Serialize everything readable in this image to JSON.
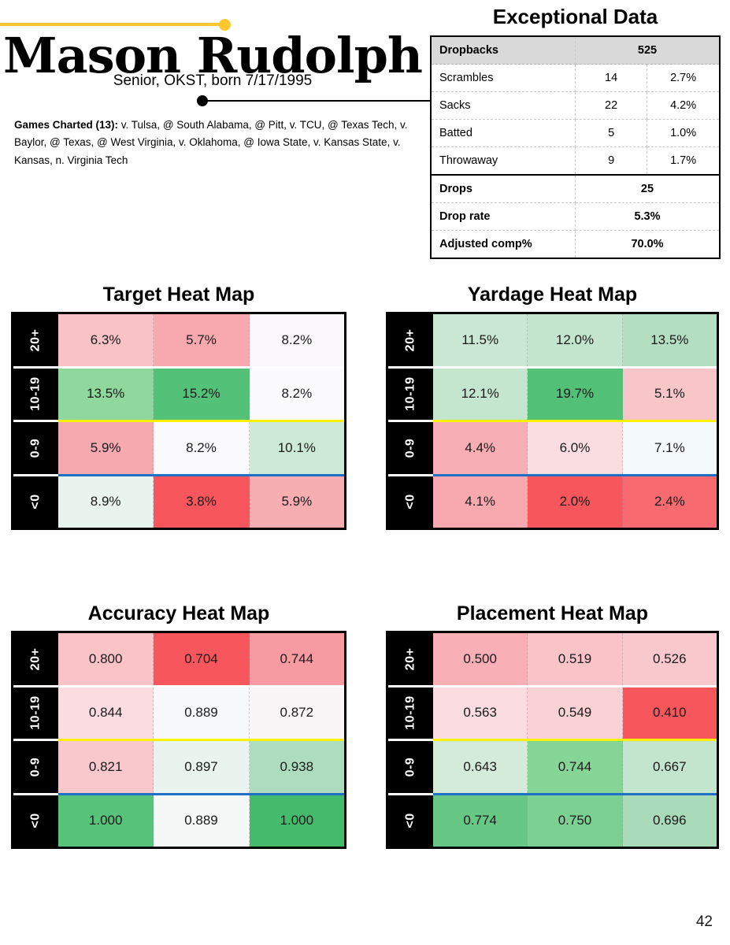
{
  "header": {
    "player_name": "Mason Rudolph",
    "subtitle": "Senior, OKST, born 7/17/1995",
    "games_label": "Games Charted (13):",
    "games_list": " v. Tulsa, @ South Alabama, @ Pitt, v. TCU, @ Texas Tech, v. Baylor, @ Texas, @ West Virginia, v. Oklahoma, @ Iowa State, v. Kansas State, v. Kansas, n. Virginia Tech",
    "accent_yellow": "#FDC82F",
    "connector_black": "#000000"
  },
  "exceptional": {
    "title": "Exceptional Data",
    "rows": [
      {
        "label": "Dropbacks",
        "value": "525",
        "pct": "",
        "style": "header",
        "span": true
      },
      {
        "label": "Scrambles",
        "value": "14",
        "pct": "2.7%",
        "style": "normal",
        "span": false
      },
      {
        "label": "Sacks",
        "value": "22",
        "pct": "4.2%",
        "style": "normal",
        "span": false
      },
      {
        "label": "Batted",
        "value": "5",
        "pct": "1.0%",
        "style": "normal",
        "span": false
      },
      {
        "label": "Throwaway",
        "value": "9",
        "pct": "1.7%",
        "style": "section-end",
        "span": false
      },
      {
        "label": "Drops",
        "value": "25",
        "pct": "",
        "style": "bold",
        "span": true
      },
      {
        "label": "Drop rate",
        "value": "5.3%",
        "pct": "",
        "style": "bold",
        "span": true
      },
      {
        "label": "Adjusted comp%",
        "value": "70.0%",
        "pct": "",
        "style": "bold",
        "span": true
      }
    ]
  },
  "heatmaps": {
    "row_labels": [
      "20+",
      "10-19",
      "0-9",
      "<0"
    ],
    "separators": [
      "white",
      "yellow",
      "blue"
    ],
    "separator_colors": {
      "white": "#FFFFFF",
      "yellow": "#FFF200",
      "blue": "#1F6FC4"
    },
    "maps": [
      {
        "key": "target",
        "title": "Target Heat Map",
        "values": [
          [
            "6.3%",
            "5.7%",
            "8.2%"
          ],
          [
            "13.5%",
            "15.2%",
            "8.2%"
          ],
          [
            "5.9%",
            "8.2%",
            "10.1%"
          ],
          [
            "8.9%",
            "3.8%",
            "5.9%"
          ]
        ],
        "colors": [
          [
            "#F9C2C6",
            "#F7A9AF",
            "#FAF8FB"
          ],
          [
            "#8FD79C",
            "#53C177",
            "#FBFAFC"
          ],
          [
            "#F6A9AF",
            "#FBFAFD",
            "#CEE9D5"
          ],
          [
            "#E9F4EE",
            "#F6565C",
            "#F6AEB3"
          ]
        ]
      },
      {
        "key": "yardage",
        "title": "Yardage Heat Map",
        "values": [
          [
            "11.5%",
            "12.0%",
            "13.5%"
          ],
          [
            "12.1%",
            "19.7%",
            "5.1%"
          ],
          [
            "4.4%",
            "6.0%",
            "7.1%"
          ],
          [
            "4.1%",
            "2.0%",
            "2.4%"
          ]
        ],
        "colors": [
          [
            "#C9E7D2",
            "#C3E5CE",
            "#B3DEC1"
          ],
          [
            "#C4E5CE",
            "#52C077",
            "#F8C5C9"
          ],
          [
            "#F7AEB4",
            "#FADDE0",
            "#F4F9FA"
          ],
          [
            "#F7A9AF",
            "#F6565C",
            "#F66A70"
          ]
        ]
      },
      {
        "key": "accuracy",
        "title": "Accuracy Heat Map",
        "values": [
          [
            "0.800",
            "0.704",
            "0.744"
          ],
          [
            "0.844",
            "0.889",
            "0.872"
          ],
          [
            "0.821",
            "0.897",
            "0.938"
          ],
          [
            "1.000",
            "0.889",
            "1.000"
          ]
        ],
        "colors": [
          [
            "#F9C3C7",
            "#F6565C",
            "#F79BA2"
          ],
          [
            "#FBDCE0",
            "#F6F8F9",
            "#FAF6F8"
          ],
          [
            "#F9C8CC",
            "#E9F4EE",
            "#AEDCBE"
          ],
          [
            "#56C27A",
            "#F4F8F7",
            "#44BA6C"
          ]
        ]
      },
      {
        "key": "placement",
        "title": "Placement Heat Map",
        "values": [
          [
            "0.500",
            "0.519",
            "0.526"
          ],
          [
            "0.563",
            "0.549",
            "0.410"
          ],
          [
            "0.643",
            "0.744",
            "0.667"
          ],
          [
            "0.774",
            "0.750",
            "0.696"
          ]
        ],
        "colors": [
          [
            "#F8AFB5",
            "#F9C3C8",
            "#F9C8CC"
          ],
          [
            "#FBDCE0",
            "#FAD2D6",
            "#F6565C"
          ],
          [
            "#D4EBDA",
            "#86D496",
            "#C3E5CE"
          ],
          [
            "#67C886",
            "#7CD092",
            "#A9DAB9"
          ]
        ]
      }
    ]
  },
  "page_number": "42"
}
